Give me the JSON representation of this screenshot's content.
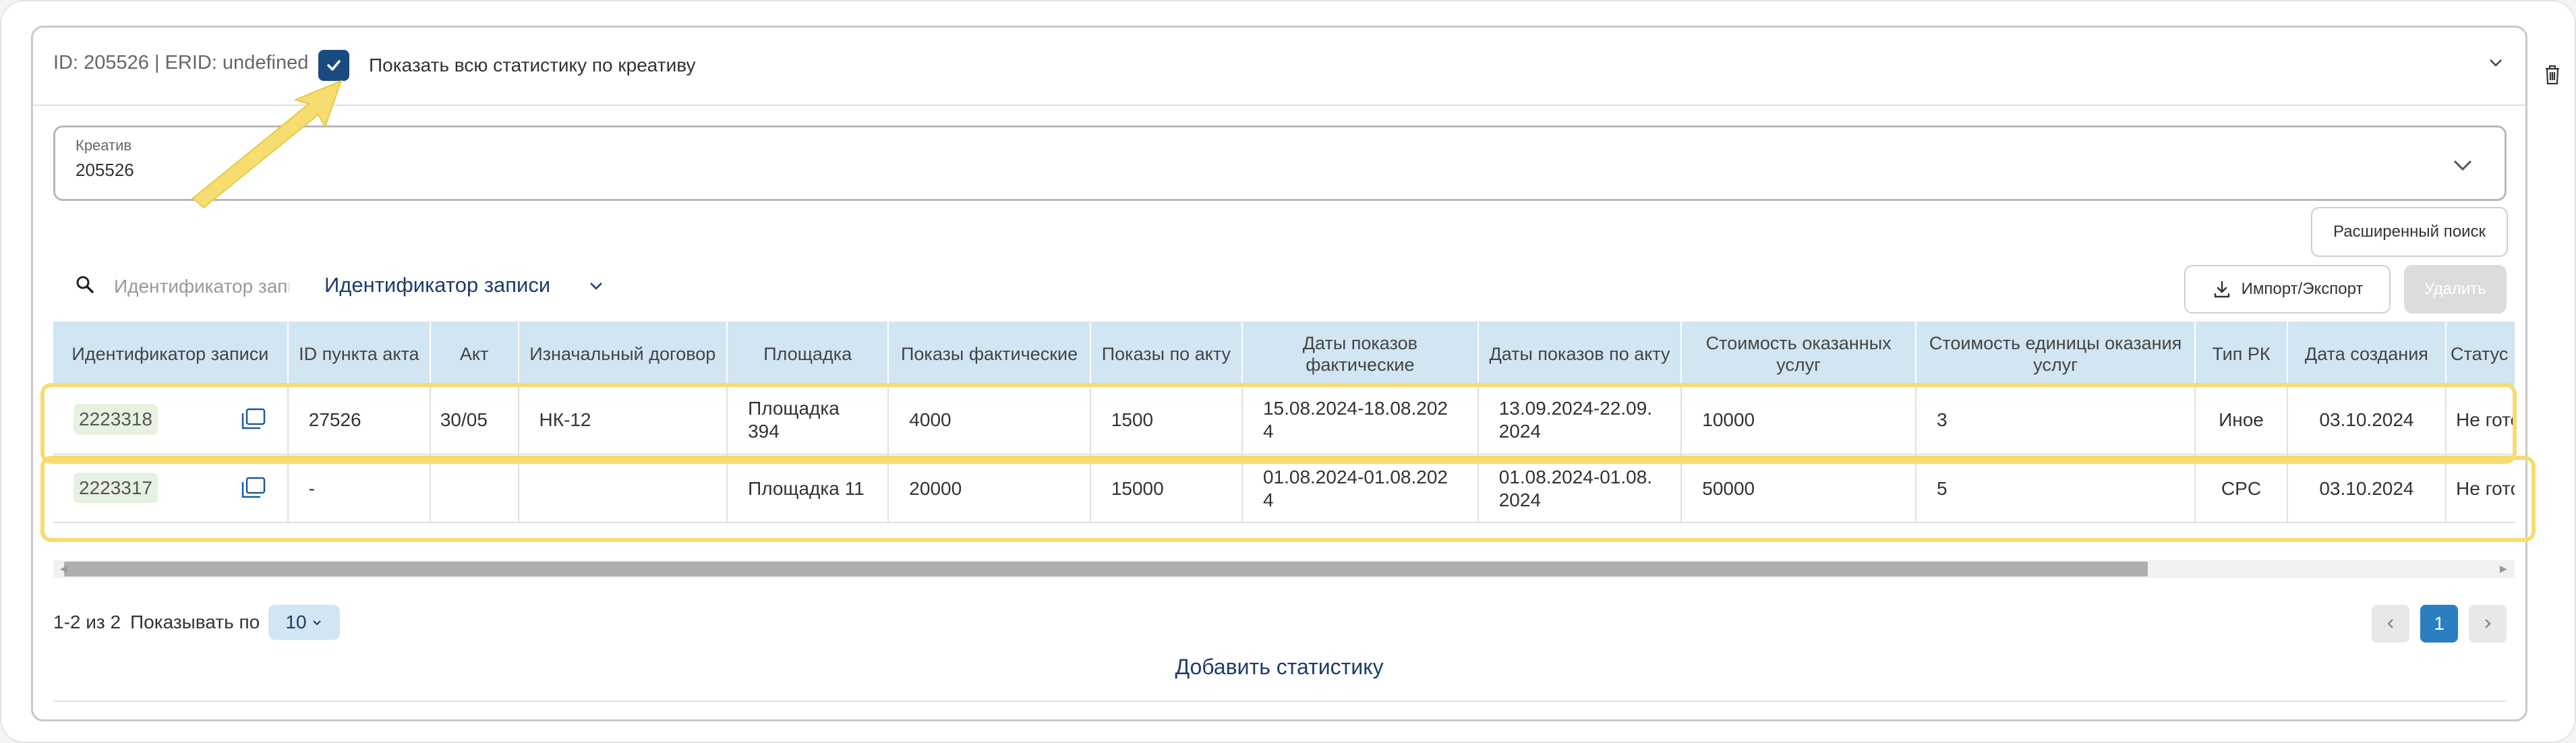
{
  "header": {
    "id_text": "ID: 205526 | ERID: undefined",
    "show_all_label": "Показать всю статистику по креативу",
    "show_all_checked": true
  },
  "creative_select": {
    "label": "Креатив",
    "value": "205526"
  },
  "buttons": {
    "advanced_search": "Расширенный поиск",
    "import_export": "Импорт/Экспорт",
    "delete": "Удалить",
    "add_statistics": "Добавить статистику"
  },
  "search": {
    "placeholder": "Идентификатор записи",
    "field_select": "Идентификатор записи"
  },
  "table": {
    "columns": [
      "Идентификатор записи",
      "ID пункта акта",
      "Акт",
      "Изначальный договор",
      "Площадка",
      "Показы фактические",
      "Показы по акту",
      "Даты показов фактические",
      "Даты показов по акту",
      "Стоимость оказанных услуг",
      "Стоимость единицы оказания услуг",
      "Тип РК",
      "Дата создания",
      "Статус"
    ],
    "rows": [
      {
        "record_id": "2223318",
        "act_item_id": "27526",
        "act": "30/05",
        "original_contract": "НК-12",
        "platform": "Площадка 394",
        "impressions_actual": "4000",
        "impressions_act": "1500",
        "dates_actual": "15.08.2024-18.08.2024",
        "dates_act": "13.09.2024-22.09.2024",
        "cost_services": "10000",
        "unit_cost": "3",
        "campaign_type": "Иное",
        "created_date": "03.10.2024",
        "status": "Не готов"
      },
      {
        "record_id": "2223317",
        "act_item_id": "-",
        "act": "",
        "original_contract": "",
        "platform": "Площадка 11",
        "impressions_actual": "20000",
        "impressions_act": "15000",
        "dates_actual": "01.08.2024-01.08.2024",
        "dates_act": "01.08.2024-01.08.2024",
        "cost_services": "50000",
        "unit_cost": "5",
        "campaign_type": "CPC",
        "created_date": "03.10.2024",
        "status": "Не готов"
      }
    ]
  },
  "pagination": {
    "range_text": "1-2 из 2",
    "show_label": "Показывать по",
    "page_size": "10",
    "current_page": "1"
  },
  "colors": {
    "accent_dark": "#1a4b80",
    "table_header": "#d2e5f2",
    "highlight": "#f7dc6f",
    "page_active": "#2b7fc0"
  }
}
